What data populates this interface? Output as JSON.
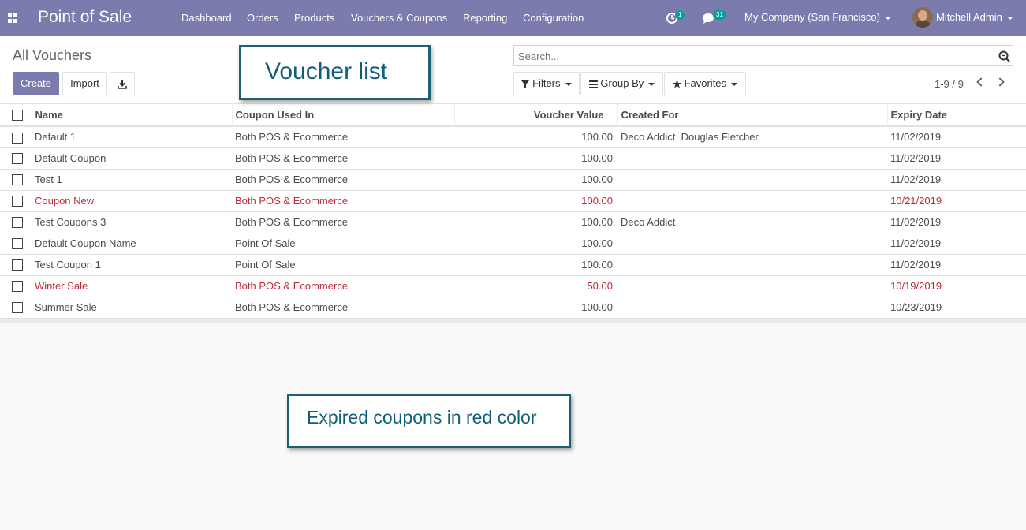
{
  "navbar": {
    "brand": "Point of Sale",
    "menus": [
      "Dashboard",
      "Orders",
      "Products",
      "Vouchers & Coupons",
      "Reporting",
      "Configuration"
    ],
    "activity_count": "1",
    "message_count": "31",
    "company": "My Company (San Francisco)",
    "user": "Mitchell Admin"
  },
  "control_panel": {
    "title": "All Vouchers",
    "create_label": "Create",
    "import_label": "Import",
    "search_placeholder": "Search...",
    "filters_label": "Filters",
    "groupby_label": "Group By",
    "favorites_label": "Favorites",
    "pager": "1-9 / 9"
  },
  "callouts": {
    "top": "Voucher list",
    "bottom": "Expired coupons in red color"
  },
  "table": {
    "headers": {
      "name": "Name",
      "used_in": "Coupon Used In",
      "value": "Voucher Value",
      "created_for": "Created For",
      "expiry": "Expiry Date"
    },
    "rows": [
      {
        "name": "Default 1",
        "used_in": "Both POS & Ecommerce",
        "value": "100.00",
        "created_for": "Deco Addict, Douglas Fletcher",
        "expiry": "11/02/2019",
        "expired": false
      },
      {
        "name": "Default Coupon",
        "used_in": "Both POS & Ecommerce",
        "value": "100.00",
        "created_for": "",
        "expiry": "11/02/2019",
        "expired": false
      },
      {
        "name": "Test 1",
        "used_in": "Both POS & Ecommerce",
        "value": "100.00",
        "created_for": "",
        "expiry": "11/02/2019",
        "expired": false
      },
      {
        "name": "Coupon New",
        "used_in": "Both POS & Ecommerce",
        "value": "100.00",
        "created_for": "",
        "expiry": "10/21/2019",
        "expired": true
      },
      {
        "name": "Test Coupons 3",
        "used_in": "Both POS & Ecommerce",
        "value": "100.00",
        "created_for": "Deco Addict",
        "expiry": "11/02/2019",
        "expired": false
      },
      {
        "name": "Default Coupon Name",
        "used_in": "Point Of Sale",
        "value": "100.00",
        "created_for": "",
        "expiry": "11/02/2019",
        "expired": false
      },
      {
        "name": "Test Coupon 1",
        "used_in": "Point Of Sale",
        "value": "100.00",
        "created_for": "",
        "expiry": "11/02/2019",
        "expired": false
      },
      {
        "name": "Winter Sale",
        "used_in": "Both POS & Ecommerce",
        "value": "50.00",
        "created_for": "",
        "expiry": "10/19/2019",
        "expired": true
      },
      {
        "name": "Summer Sale",
        "used_in": "Both POS & Ecommerce",
        "value": "100.00",
        "created_for": "",
        "expiry": "10/23/2019",
        "expired": false
      }
    ]
  },
  "colors": {
    "brand": "#7c7bad",
    "expired": "#bf2a3a",
    "badge": "#00a09d",
    "callout_text": "#0f5f7a"
  }
}
